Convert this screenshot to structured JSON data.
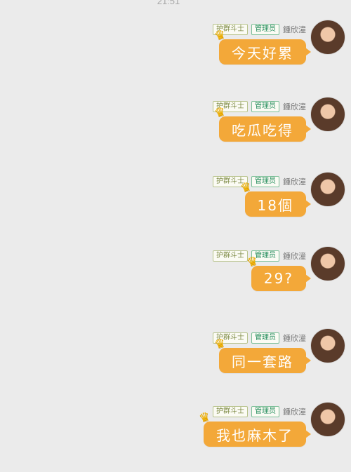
{
  "time": "21:51",
  "messages": [
    {
      "name": "鍾欣潼",
      "badges": [
        "护群斗士",
        "管理员"
      ],
      "text": "今天好累"
    },
    {
      "name": "鍾欣潼",
      "badges": [
        "护群斗士",
        "管理员"
      ],
      "text": "吃瓜吃得"
    },
    {
      "name": "鍾欣潼",
      "badges": [
        "护群斗士",
        "管理员"
      ],
      "text": "18個"
    },
    {
      "name": "鍾欣潼",
      "badges": [
        "护群斗士",
        "管理员"
      ],
      "text": "29?"
    },
    {
      "name": "鍾欣潼",
      "badges": [
        "护群斗士",
        "管理员"
      ],
      "text": "同一套路"
    },
    {
      "name": "鍾欣潼",
      "badges": [
        "护群斗士",
        "管理员"
      ],
      "text": "我也麻木了"
    }
  ],
  "icons": {
    "crown": "crown-icon"
  }
}
